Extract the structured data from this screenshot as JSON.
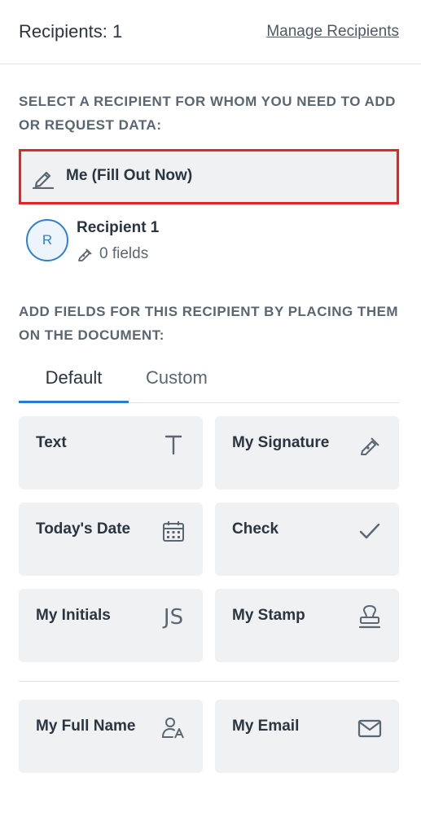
{
  "header": {
    "title": "Recipients: 1",
    "manage_link": "Manage Recipients"
  },
  "select_section": {
    "label": "SELECT A RECIPIENT FOR WHOM YOU NEED TO ADD OR REQUEST DATA:",
    "me_option": "Me (Fill Out Now)",
    "recipient": {
      "initial": "R",
      "name": "Recipient 1",
      "fields_count": "0 fields"
    }
  },
  "fields_section": {
    "label": "ADD FIELDS FOR THIS RECIPIENT BY PLACING THEM ON THE DOCUMENT:",
    "tabs": [
      {
        "label": "Default",
        "active": true
      },
      {
        "label": "Custom",
        "active": false
      }
    ],
    "fields": [
      {
        "label": "Text",
        "icon": "text-t-icon"
      },
      {
        "label": "My Signature",
        "icon": "signature-pen-icon"
      },
      {
        "label": "Today's Date",
        "icon": "calendar-icon"
      },
      {
        "label": "Check",
        "icon": "checkmark-icon"
      },
      {
        "label": "My Initials",
        "icon": "initials-js-icon",
        "glyph": "JS"
      },
      {
        "label": "My Stamp",
        "icon": "stamp-icon"
      },
      {
        "label": "My Full Name",
        "icon": "person-name-icon"
      },
      {
        "label": "My Email",
        "icon": "envelope-icon"
      }
    ]
  },
  "colors": {
    "accent_blue": "#2a7bd3",
    "highlight_red": "#e12626",
    "tile_bg": "#eff1f3"
  }
}
